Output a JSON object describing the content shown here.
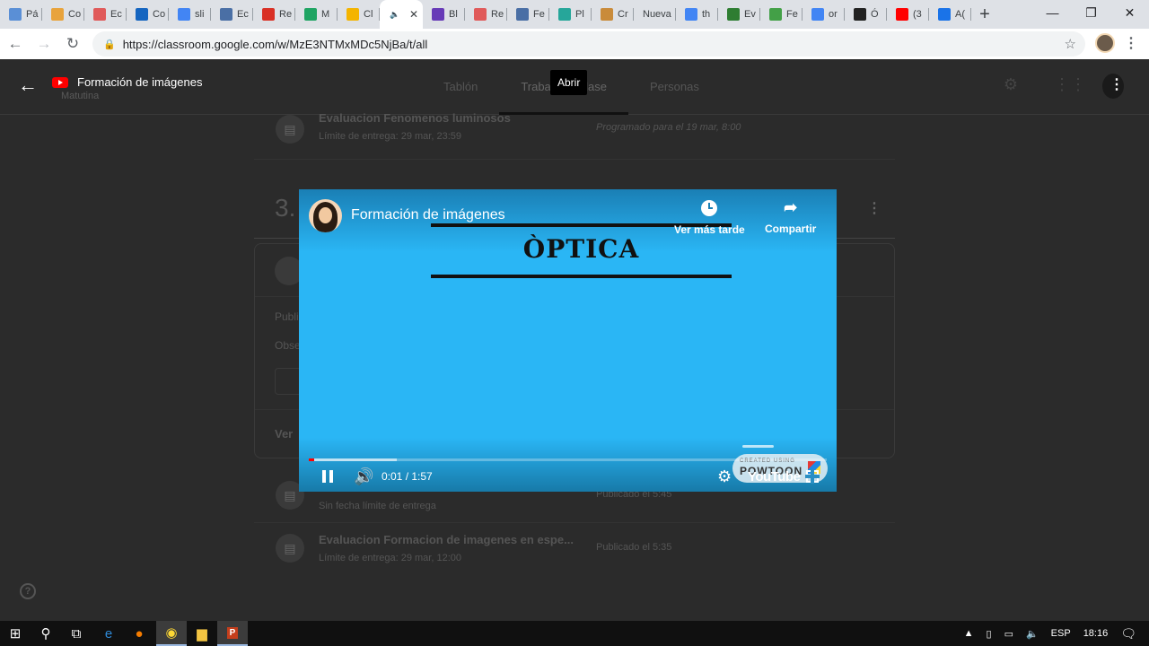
{
  "browser": {
    "tabs": [
      {
        "label": "Pá",
        "icon": "globe-icon",
        "color": "#5a8fd6"
      },
      {
        "label": "Co",
        "icon": "hat-icon",
        "color": "#e8a33c"
      },
      {
        "label": "Ec",
        "icon": "s-icon",
        "color": "#e05a5a"
      },
      {
        "label": "Co",
        "icon": "outlook-icon",
        "color": "#1565c0"
      },
      {
        "label": "sli",
        "icon": "google-icon",
        "color": "#4285f4"
      },
      {
        "label": "Ec",
        "icon": "classroom-icon",
        "color": "#4a6fa5"
      },
      {
        "label": "Re",
        "icon": "gmail-icon",
        "color": "#d93025"
      },
      {
        "label": "M",
        "icon": "drive-icon",
        "color": "#1fa463"
      },
      {
        "label": "Cl",
        "icon": "classroom-icon",
        "color": "#f4b400"
      },
      {
        "label": "",
        "icon": "audio-icon",
        "color": "#5f6368",
        "active": true
      },
      {
        "label": "Bl",
        "icon": "forms-icon",
        "color": "#673ab7"
      },
      {
        "label": "Re",
        "icon": "s-icon",
        "color": "#e05a5a"
      },
      {
        "label": "Fe",
        "icon": "classroom-icon",
        "color": "#4a6fa5"
      },
      {
        "label": "Pl",
        "icon": "k-icon",
        "color": "#26a69a"
      },
      {
        "label": "Cr",
        "icon": "palette-icon",
        "color": "#c98b3a"
      },
      {
        "label": "Nueva",
        "icon": "",
        "color": ""
      },
      {
        "label": "th",
        "icon": "google-icon",
        "color": "#4285f4"
      },
      {
        "label": "Ev",
        "icon": "px-icon",
        "color": "#2e7d32"
      },
      {
        "label": "Fe",
        "icon": "mail-icon",
        "color": "#43a047"
      },
      {
        "label": "or",
        "icon": "google-icon",
        "color": "#4285f4"
      },
      {
        "label": "Ó",
        "icon": "wikipedia-icon",
        "color": "#222222"
      },
      {
        "label": "(3",
        "icon": "youtube-icon",
        "color": "#ff0000"
      },
      {
        "label": "A(",
        "icon": "layout-icon",
        "color": "#1a73e8"
      }
    ],
    "url": "https://classroom.google.com/w/MzE3NTMxMDc5NjBa/t/all"
  },
  "classroom": {
    "class_title": "Formación de imágenes",
    "class_subtitle": "Matutina",
    "tabs": [
      "Tablón",
      "Trabajo de clase",
      "Personas"
    ],
    "tooltip": "Abrir",
    "item_top": {
      "title": "Evaluacion Fenomenos luminosos",
      "due": "Límite de entrega: 29 mar, 23:59",
      "scheduled": "Programado para el 19 mar, 8:00"
    },
    "section_number": "3.",
    "card_lines": [
      "Publi",
      "Obse",
      "Ver"
    ],
    "item_mid": {
      "due": "Sin fecha límite de entrega",
      "published": "Publicado el 5:45"
    },
    "item_bottom": {
      "title": "Evaluacion Formacion de imagenes en espe...",
      "due": "Límite de entrega: 29 mar, 12:00",
      "published": "Publicado el 5:35"
    }
  },
  "player": {
    "title": "Formación de imágenes",
    "watch_later": "Ver más tarde",
    "share": "Compartir",
    "slide_text": "ÒPTICA",
    "time": "0:01 / 1:57",
    "progress_played": 0.01,
    "progress_buffered": 0.17,
    "youtube_logo": "YouTube",
    "watermark_small": "CREATED USING",
    "watermark_big": "POWTOON"
  },
  "taskbar": {
    "language": "ESP",
    "clock": "18:16"
  }
}
